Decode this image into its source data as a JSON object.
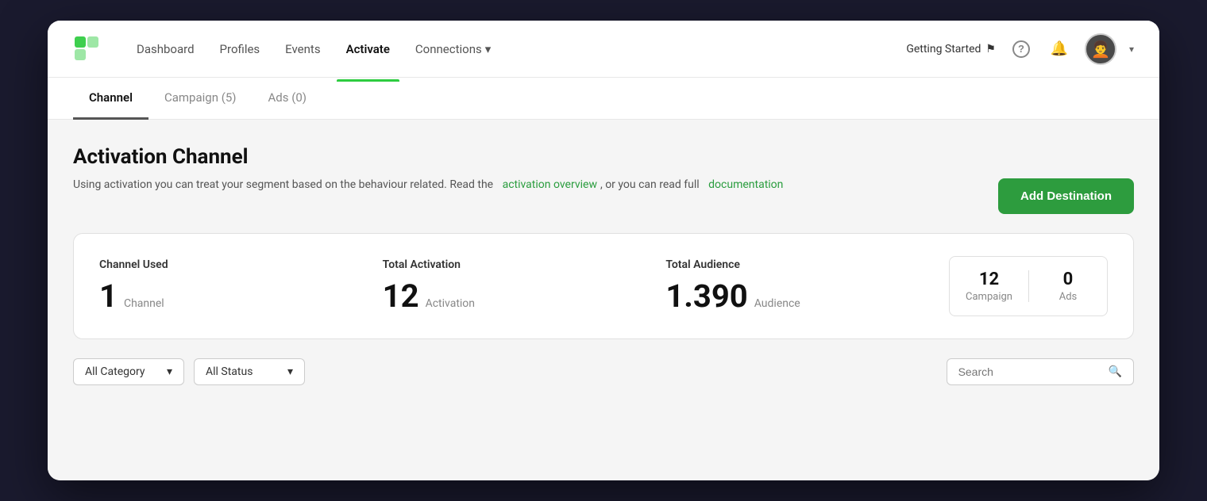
{
  "app": {
    "logo_emoji": "🟩"
  },
  "nav": {
    "links": [
      {
        "id": "dashboard",
        "label": "Dashboard",
        "active": false
      },
      {
        "id": "profiles",
        "label": "Profiles",
        "active": false
      },
      {
        "id": "events",
        "label": "Events",
        "active": false
      },
      {
        "id": "activate",
        "label": "Activate",
        "active": true
      },
      {
        "id": "connections",
        "label": "Connections",
        "active": false,
        "has_arrow": true
      }
    ],
    "getting_started_label": "Getting Started",
    "chevron_down": "▾",
    "bell_icon": "🔔",
    "help_icon": "?",
    "avatar_emoji": "👩"
  },
  "tabs": [
    {
      "id": "channel",
      "label": "Channel",
      "active": true
    },
    {
      "id": "campaign",
      "label": "Campaign (5)",
      "active": false
    },
    {
      "id": "ads",
      "label": "Ads (0)",
      "active": false
    }
  ],
  "main": {
    "section_title": "Activation Channel",
    "description_part1": "Using activation you can treat your segment based on the behaviour related. Read the",
    "link1_label": "activation overview",
    "description_part2": ", or you can read full",
    "link2_label": "documentation",
    "add_destination_label": "Add Destination"
  },
  "stats": {
    "channel_used_label": "Channel Used",
    "channel_number": "1",
    "channel_unit": "Channel",
    "total_activation_label": "Total Activation",
    "activation_number": "12",
    "activation_unit": "Activation",
    "total_audience_label": "Total Audience",
    "audience_number": "1.390",
    "audience_unit": "Audience",
    "campaign_number": "12",
    "campaign_label": "Campaign",
    "ads_number": "0",
    "ads_label": "Ads"
  },
  "filters": {
    "category_label": "All Category",
    "status_label": "All Status",
    "search_placeholder": "Search",
    "chevron": "▾"
  },
  "colors": {
    "active_tab_underline": "#555555",
    "nav_active_underline": "#2ecc40",
    "add_btn_bg": "#2d9c3e",
    "link_color": "#2a9d3e"
  }
}
